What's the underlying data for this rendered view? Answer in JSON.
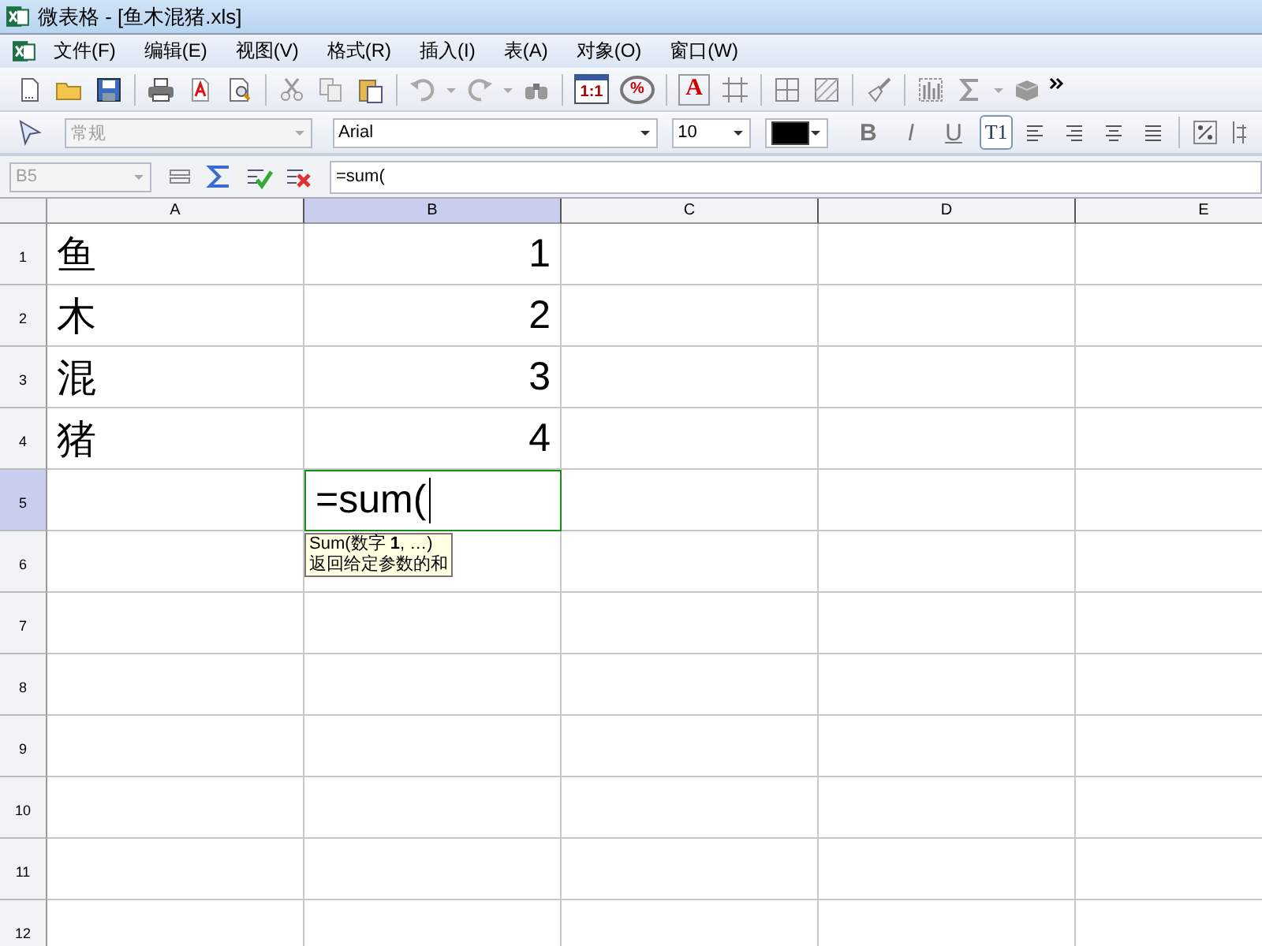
{
  "window": {
    "title": "微表格 - [鱼木混猪.xls]"
  },
  "menu": [
    "文件(F)",
    "编辑(E)",
    "视图(V)",
    "格式(R)",
    "插入(I)",
    "表(A)",
    "对象(O)",
    "窗口(W)"
  ],
  "toolbar": {
    "zoom_label": "1:1",
    "percent_label": "%",
    "font_color_label": "A"
  },
  "format_bar": {
    "number_format": "常规",
    "number_format_disabled": true,
    "font": "Arial",
    "size": "10",
    "toggles": [
      {
        "label": "B",
        "selected": false
      },
      {
        "label": "I",
        "selected": false
      },
      {
        "label": "U",
        "selected": false
      },
      {
        "label": "T1",
        "selected": true
      }
    ]
  },
  "formula_bar": {
    "cell_ref": "B5",
    "cell_ref_disabled": true,
    "formula": "=sum("
  },
  "columns": [
    {
      "label": "A",
      "selected": false
    },
    {
      "label": "B",
      "selected": true
    },
    {
      "label": "C",
      "selected": false
    },
    {
      "label": "D",
      "selected": false
    },
    {
      "label": "E",
      "selected": false
    }
  ],
  "rows": [
    {
      "label": "1",
      "selected": false,
      "cells": [
        {
          "text": "鱼",
          "selected": false
        },
        {
          "text": "1",
          "selected": false
        }
      ]
    },
    {
      "label": "2",
      "selected": false,
      "cells": [
        {
          "text": "木",
          "selected": false
        },
        {
          "text": "2",
          "selected": false
        }
      ]
    },
    {
      "label": "3",
      "selected": false,
      "cells": [
        {
          "text": "混",
          "selected": false
        },
        {
          "text": "3",
          "selected": false
        }
      ]
    },
    {
      "label": "4",
      "selected": false,
      "cells": [
        {
          "text": "猪",
          "selected": false
        },
        {
          "text": "4",
          "selected": false
        }
      ]
    },
    {
      "label": "5",
      "selected": true,
      "cells": [
        null,
        {
          "text": "=sum(",
          "selected": true
        }
      ]
    },
    {
      "label": "6",
      "selected": false
    },
    {
      "label": "7",
      "selected": false
    },
    {
      "label": "8",
      "selected": false
    },
    {
      "label": "9",
      "selected": false
    },
    {
      "label": "10",
      "selected": false
    },
    {
      "label": "11",
      "selected": false
    },
    {
      "label": "12",
      "selected": false
    }
  ],
  "tooltip": {
    "signature": "Sum(数字 **1**, …)",
    "description": "返回给定参数的和"
  }
}
